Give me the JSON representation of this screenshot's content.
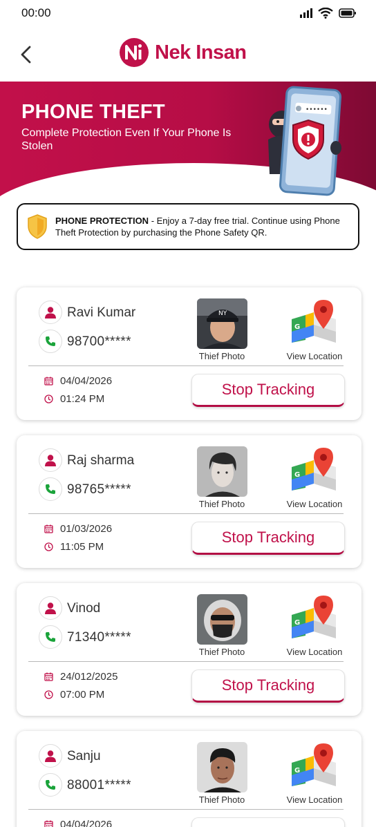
{
  "status": {
    "time": "00:00"
  },
  "header": {
    "brand": "Nek Insan"
  },
  "hero": {
    "title": "PHONE THEFT",
    "subtitle": "Complete Protection Even If Your Phone Is Stolen"
  },
  "promo": {
    "bold": "PHONE PROTECTION",
    "text": " - Enjoy a 7-day free trial. Continue using Phone Theft Protection by purchasing the Phone Safety QR."
  },
  "labels": {
    "thief_photo": "Thief Photo",
    "view_location": "View Location",
    "stop_tracking": "Stop Tracking"
  },
  "colors": {
    "brand": "#c0114a",
    "phone_icon": "#1aa33a"
  },
  "records": [
    {
      "name": "Ravi Kumar",
      "phone": "98700*****",
      "date": "04/04/2026",
      "time": "01:24 PM"
    },
    {
      "name": "Raj sharma",
      "phone": "98765*****",
      "date": "01/03/2026",
      "time": "11:05 PM"
    },
    {
      "name": "Vinod",
      "phone": "71340*****",
      "date": "24/012/2025",
      "time": "07:00 PM"
    },
    {
      "name": "Sanju",
      "phone": "88001*****",
      "date": "04/04/2026",
      "time": ""
    }
  ]
}
